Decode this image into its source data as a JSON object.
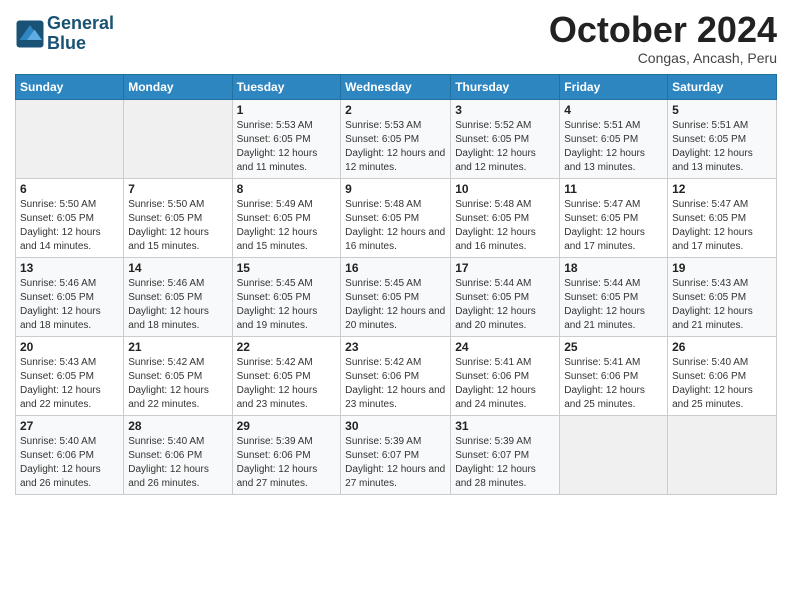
{
  "header": {
    "logo_line1": "General",
    "logo_line2": "Blue",
    "month": "October 2024",
    "location": "Congas, Ancash, Peru"
  },
  "weekdays": [
    "Sunday",
    "Monday",
    "Tuesday",
    "Wednesday",
    "Thursday",
    "Friday",
    "Saturday"
  ],
  "weeks": [
    [
      {
        "day": "",
        "info": ""
      },
      {
        "day": "",
        "info": ""
      },
      {
        "day": "1",
        "info": "Sunrise: 5:53 AM\nSunset: 6:05 PM\nDaylight: 12 hours and 11 minutes."
      },
      {
        "day": "2",
        "info": "Sunrise: 5:53 AM\nSunset: 6:05 PM\nDaylight: 12 hours and 12 minutes."
      },
      {
        "day": "3",
        "info": "Sunrise: 5:52 AM\nSunset: 6:05 PM\nDaylight: 12 hours and 12 minutes."
      },
      {
        "day": "4",
        "info": "Sunrise: 5:51 AM\nSunset: 6:05 PM\nDaylight: 12 hours and 13 minutes."
      },
      {
        "day": "5",
        "info": "Sunrise: 5:51 AM\nSunset: 6:05 PM\nDaylight: 12 hours and 13 minutes."
      }
    ],
    [
      {
        "day": "6",
        "info": "Sunrise: 5:50 AM\nSunset: 6:05 PM\nDaylight: 12 hours and 14 minutes."
      },
      {
        "day": "7",
        "info": "Sunrise: 5:50 AM\nSunset: 6:05 PM\nDaylight: 12 hours and 15 minutes."
      },
      {
        "day": "8",
        "info": "Sunrise: 5:49 AM\nSunset: 6:05 PM\nDaylight: 12 hours and 15 minutes."
      },
      {
        "day": "9",
        "info": "Sunrise: 5:48 AM\nSunset: 6:05 PM\nDaylight: 12 hours and 16 minutes."
      },
      {
        "day": "10",
        "info": "Sunrise: 5:48 AM\nSunset: 6:05 PM\nDaylight: 12 hours and 16 minutes."
      },
      {
        "day": "11",
        "info": "Sunrise: 5:47 AM\nSunset: 6:05 PM\nDaylight: 12 hours and 17 minutes."
      },
      {
        "day": "12",
        "info": "Sunrise: 5:47 AM\nSunset: 6:05 PM\nDaylight: 12 hours and 17 minutes."
      }
    ],
    [
      {
        "day": "13",
        "info": "Sunrise: 5:46 AM\nSunset: 6:05 PM\nDaylight: 12 hours and 18 minutes."
      },
      {
        "day": "14",
        "info": "Sunrise: 5:46 AM\nSunset: 6:05 PM\nDaylight: 12 hours and 18 minutes."
      },
      {
        "day": "15",
        "info": "Sunrise: 5:45 AM\nSunset: 6:05 PM\nDaylight: 12 hours and 19 minutes."
      },
      {
        "day": "16",
        "info": "Sunrise: 5:45 AM\nSunset: 6:05 PM\nDaylight: 12 hours and 20 minutes."
      },
      {
        "day": "17",
        "info": "Sunrise: 5:44 AM\nSunset: 6:05 PM\nDaylight: 12 hours and 20 minutes."
      },
      {
        "day": "18",
        "info": "Sunrise: 5:44 AM\nSunset: 6:05 PM\nDaylight: 12 hours and 21 minutes."
      },
      {
        "day": "19",
        "info": "Sunrise: 5:43 AM\nSunset: 6:05 PM\nDaylight: 12 hours and 21 minutes."
      }
    ],
    [
      {
        "day": "20",
        "info": "Sunrise: 5:43 AM\nSunset: 6:05 PM\nDaylight: 12 hours and 22 minutes."
      },
      {
        "day": "21",
        "info": "Sunrise: 5:42 AM\nSunset: 6:05 PM\nDaylight: 12 hours and 22 minutes."
      },
      {
        "day": "22",
        "info": "Sunrise: 5:42 AM\nSunset: 6:05 PM\nDaylight: 12 hours and 23 minutes."
      },
      {
        "day": "23",
        "info": "Sunrise: 5:42 AM\nSunset: 6:06 PM\nDaylight: 12 hours and 23 minutes."
      },
      {
        "day": "24",
        "info": "Sunrise: 5:41 AM\nSunset: 6:06 PM\nDaylight: 12 hours and 24 minutes."
      },
      {
        "day": "25",
        "info": "Sunrise: 5:41 AM\nSunset: 6:06 PM\nDaylight: 12 hours and 25 minutes."
      },
      {
        "day": "26",
        "info": "Sunrise: 5:40 AM\nSunset: 6:06 PM\nDaylight: 12 hours and 25 minutes."
      }
    ],
    [
      {
        "day": "27",
        "info": "Sunrise: 5:40 AM\nSunset: 6:06 PM\nDaylight: 12 hours and 26 minutes."
      },
      {
        "day": "28",
        "info": "Sunrise: 5:40 AM\nSunset: 6:06 PM\nDaylight: 12 hours and 26 minutes."
      },
      {
        "day": "29",
        "info": "Sunrise: 5:39 AM\nSunset: 6:06 PM\nDaylight: 12 hours and 27 minutes."
      },
      {
        "day": "30",
        "info": "Sunrise: 5:39 AM\nSunset: 6:07 PM\nDaylight: 12 hours and 27 minutes."
      },
      {
        "day": "31",
        "info": "Sunrise: 5:39 AM\nSunset: 6:07 PM\nDaylight: 12 hours and 28 minutes."
      },
      {
        "day": "",
        "info": ""
      },
      {
        "day": "",
        "info": ""
      }
    ]
  ]
}
